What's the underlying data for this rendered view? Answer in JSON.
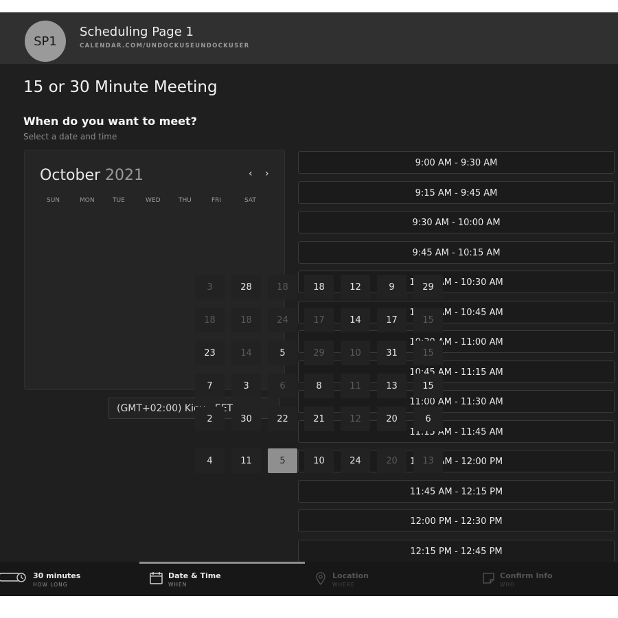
{
  "header": {
    "avatar_text": "SP1",
    "title": "Scheduling Page 1",
    "url": "CALENDAR.COM/UNDOCKUSEUNDOCKUSER"
  },
  "meeting_title": "15 or 30 Minute Meeting",
  "question": "When do you want to meet?",
  "hint": "Select a date and time",
  "calendar": {
    "month": "October",
    "year": "2021",
    "prev_icon": "‹",
    "next_icon": "›",
    "weekdays": [
      "SUN",
      "MON",
      "TUE",
      "WED",
      "THU",
      "FRI",
      "SAT"
    ],
    "days": [
      {
        "text": "3",
        "dim": true
      },
      {
        "text": "28",
        "dim": false
      },
      {
        "text": "18",
        "dim": true
      },
      {
        "text": "18",
        "dim": false
      },
      {
        "text": "12",
        "dim": false
      },
      {
        "text": "9",
        "dim": false
      },
      {
        "text": "29",
        "dim": false
      },
      {
        "text": "18",
        "dim": true
      },
      {
        "text": "18",
        "dim": true
      },
      {
        "text": "24",
        "dim": true
      },
      {
        "text": "17",
        "dim": true
      },
      {
        "text": "14",
        "dim": false
      },
      {
        "text": "17",
        "dim": false
      },
      {
        "text": "15",
        "dim": true
      },
      {
        "text": "23",
        "dim": false
      },
      {
        "text": "14",
        "dim": true
      },
      {
        "text": "5",
        "dim": false
      },
      {
        "text": "29",
        "dim": true
      },
      {
        "text": "10",
        "dim": true
      },
      {
        "text": "31",
        "dim": false
      },
      {
        "text": "15",
        "dim": true
      },
      {
        "text": "7",
        "dim": false
      },
      {
        "text": "3",
        "dim": false
      },
      {
        "text": "6",
        "dim": true
      },
      {
        "text": "8",
        "dim": false
      },
      {
        "text": "11",
        "dim": true
      },
      {
        "text": "13",
        "dim": false
      },
      {
        "text": "15",
        "dim": false
      },
      {
        "text": "2",
        "dim": false
      },
      {
        "text": "30",
        "dim": false
      },
      {
        "text": "22",
        "dim": false
      },
      {
        "text": "21",
        "dim": false
      },
      {
        "text": "12",
        "dim": true
      },
      {
        "text": "20",
        "dim": false
      },
      {
        "text": "6",
        "dim": false
      },
      {
        "text": "4",
        "dim": false
      },
      {
        "text": "11",
        "dim": false
      },
      {
        "text": "5",
        "dim": false,
        "selected": true
      },
      {
        "text": "10",
        "dim": false
      },
      {
        "text": "24",
        "dim": false
      },
      {
        "text": "20",
        "dim": true
      },
      {
        "text": "13",
        "dim": true
      }
    ]
  },
  "timezone": "(GMT+02:00) Kiev - EET",
  "slots": [
    "9:00 AM - 9:30 AM",
    "9:15 AM - 9:45 AM",
    "9:30 AM - 10:00 AM",
    "9:45 AM - 10:15 AM",
    "10:00 AM - 10:30 AM",
    "10:15 AM - 10:45 AM",
    "10:30 AM - 11:00 AM",
    "10:45 AM - 11:15 AM",
    "11:00 AM - 11:30 AM",
    "11:15 AM - 11:45 AM",
    "11:30 AM - 12:00 PM",
    "11:45 AM - 12:15 PM",
    "12:00 PM - 12:30 PM",
    "12:15 PM - 12:45 PM"
  ],
  "steps": [
    {
      "label": "30 minutes",
      "sub": "HOW LONG",
      "icon": "clock-icon"
    },
    {
      "label": "Date & Time",
      "sub": "WHEN",
      "icon": "calendar-icon"
    },
    {
      "label": "Location",
      "sub": "WHERE",
      "icon": "location-pin-icon"
    },
    {
      "label": "Confirm Info",
      "sub": "WHO",
      "icon": "note-icon"
    }
  ],
  "colors": {
    "background": "#1f1f1f",
    "header": "#303030",
    "selected_day": "#8f8f8f"
  }
}
